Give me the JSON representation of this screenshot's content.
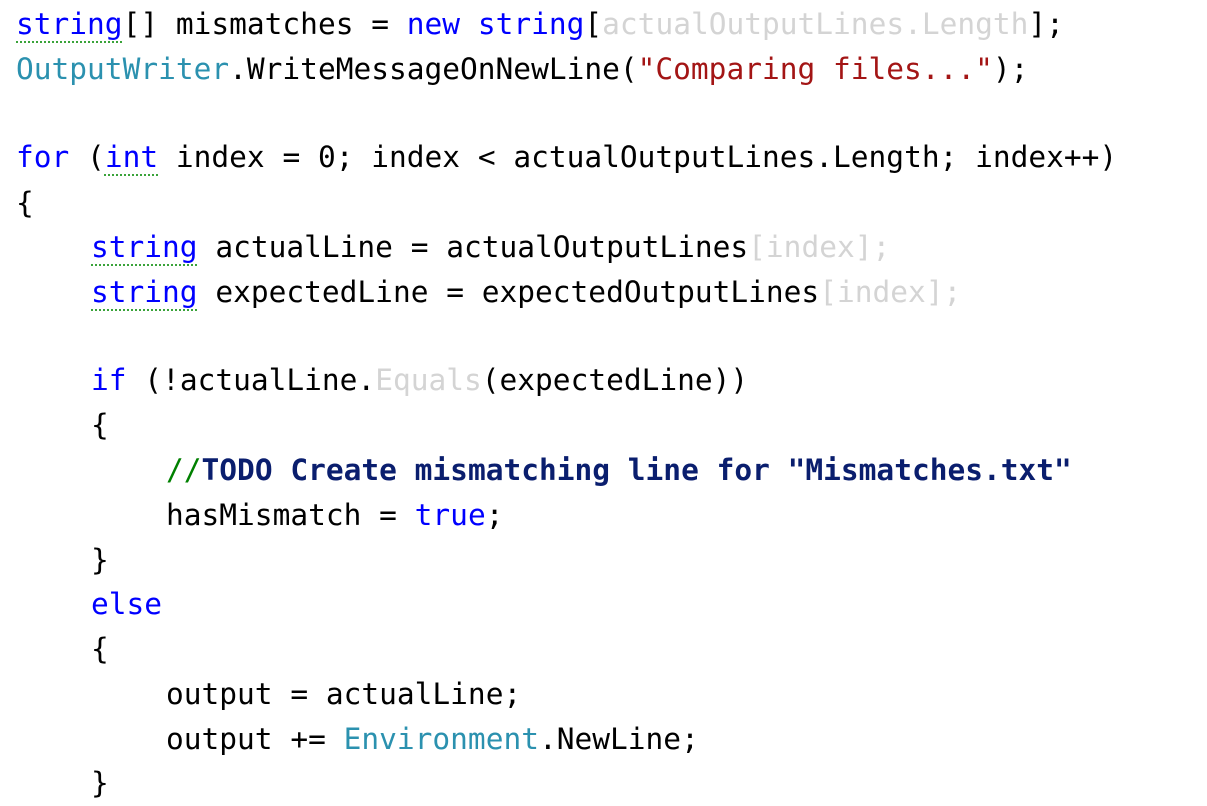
{
  "code": {
    "l1": {
      "kw_string": "string",
      "a": "[] mismatches = ",
      "kw_new": "new",
      "sp": " ",
      "kw_string2": "string",
      "lb": "[",
      "faded": "actualOutputLines.Length",
      "end": "];"
    },
    "l2": {
      "type": "OutputWriter",
      "a": ".WriteMessageOnNewLine(",
      "str": "\"Comparing files...\"",
      "end": ");"
    },
    "l4": {
      "kw_for": "for",
      "a": " (",
      "kw_int": "int",
      "b": " index = 0; index < actualOutputLines.Length; index++)"
    },
    "l5": {
      "text": "{"
    },
    "l6": {
      "kw": "string",
      "a": " actualLine = actualOutputLines",
      "faded": "[index];"
    },
    "l7": {
      "kw": "string",
      "a": " expectedLine = expectedOutputLines",
      "faded": "[index];"
    },
    "l9": {
      "kw_if": "if",
      "a": " (!actualLine.",
      "faded": "Equals",
      "b": "(expectedLine))"
    },
    "l10": {
      "text": "{"
    },
    "l11": {
      "slashes": "//",
      "todo": "TODO Create mismatching line for \"Mismatches.txt\""
    },
    "l12": {
      "a": "hasMismatch = ",
      "kw_true": "true",
      "end": ";"
    },
    "l13": {
      "text": "}"
    },
    "l14": {
      "kw_else": "else"
    },
    "l15": {
      "text": "{"
    },
    "l16": {
      "text": "output = actualLine;"
    },
    "l17": {
      "a": "output += ",
      "type": "Environment",
      "b": ".NewLine;"
    },
    "l18": {
      "text": "}"
    }
  },
  "colors": {
    "keyword": "#0000ff",
    "type": "#2b91af",
    "string": "#a31515",
    "comment": "#008000",
    "todo": "#0a1e6e",
    "faded": "#d4d4d4"
  }
}
